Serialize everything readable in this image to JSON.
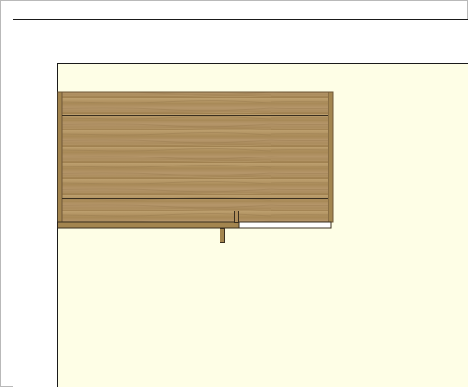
{
  "drawing": {
    "colors": {
      "canvas_background": "#ffffff",
      "viewport_border": "#b9b9b9",
      "room_wall_fill": "#ffffff",
      "room_floor_fill": "#fefee6",
      "line": "#1a1a1a",
      "wood_light": "#b89a68",
      "wood_mid": "#a98a59",
      "wood_dark": "#8f7146",
      "wood_edge": "#6f5838",
      "wood_grain": "#9c7e4f"
    }
  }
}
